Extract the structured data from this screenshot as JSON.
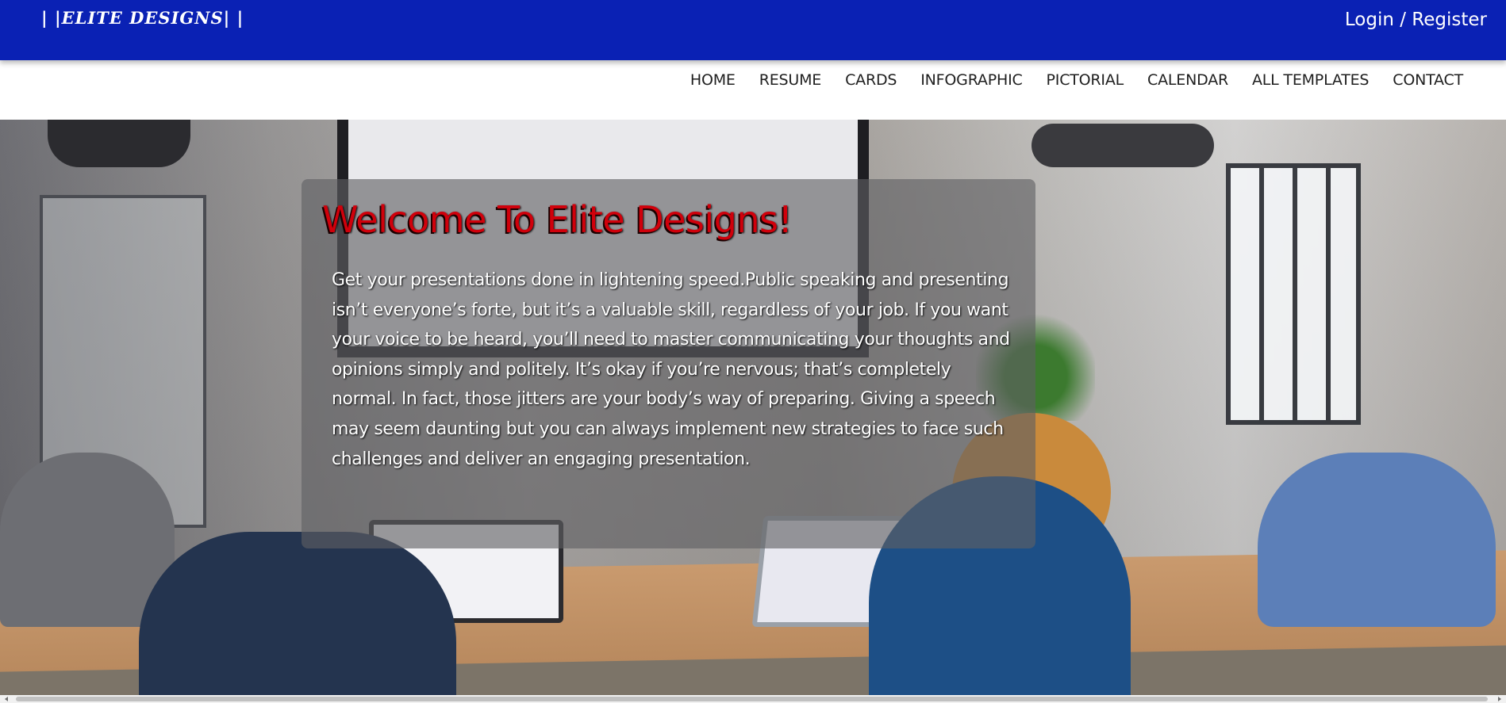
{
  "header": {
    "brand": "| |ELITE DESIGNS| |",
    "login_register": "Login / Register",
    "background_color": "#0a21b4"
  },
  "nav": {
    "items": [
      {
        "label": "HOME"
      },
      {
        "label": "RESUME"
      },
      {
        "label": "CARDS"
      },
      {
        "label": "INFOGRAPHIC"
      },
      {
        "label": "PICTORIAL"
      },
      {
        "label": "CALENDAR"
      },
      {
        "label": "ALL TEMPLATES"
      },
      {
        "label": "CONTACT"
      }
    ]
  },
  "hero": {
    "title": "Welcome To Elite Designs!",
    "title_color": "#d0000b",
    "body": "Get your presentations done in lightening speed.Public speaking and presenting isn’t everyone’s forte, but it’s a valuable skill, regardless of your job. If you want your voice to be heard, you’ll need to master communicating your thoughts and opinions simply and politely. It’s okay if you’re nervous; that’s completely normal. In fact, those jitters are your body’s way of preparing. Giving a speech may seem daunting but you can always implement new strategies to face such challenges and deliver an engaging presentation."
  }
}
